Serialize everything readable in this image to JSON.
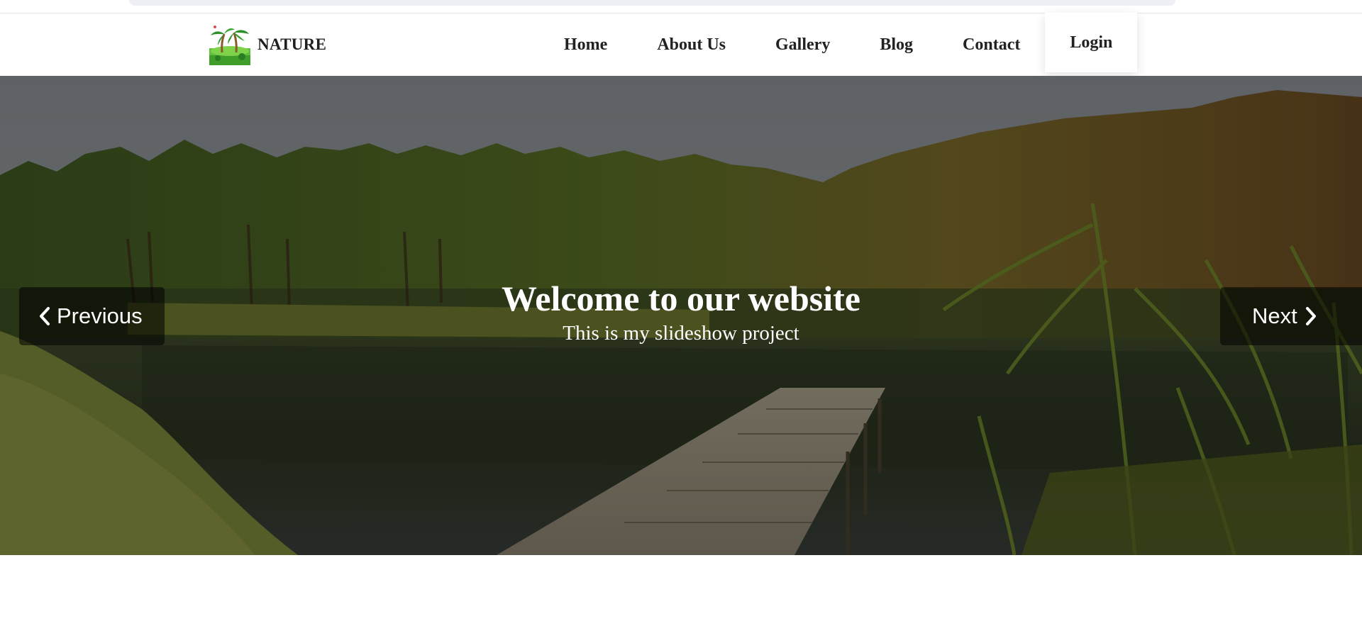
{
  "brand": {
    "name": "NATURE",
    "logo_icon": "palm-island-logo"
  },
  "nav": {
    "items": [
      {
        "label": "Home"
      },
      {
        "label": "About Us"
      },
      {
        "label": "Gallery"
      },
      {
        "label": "Blog"
      },
      {
        "label": "Contact"
      },
      {
        "label": "Login"
      }
    ]
  },
  "slideshow": {
    "title": "Welcome to our website",
    "subtitle": "This is my slideshow project",
    "prev_label": "Previous",
    "next_label": "Next",
    "prev_icon": "chevron-left-icon",
    "next_icon": "chevron-right-icon"
  },
  "colors": {
    "text_dark": "#222222",
    "overlay": "rgba(0,0,0,0.32)",
    "button_bg": "rgba(0,0,0,0.55)"
  }
}
